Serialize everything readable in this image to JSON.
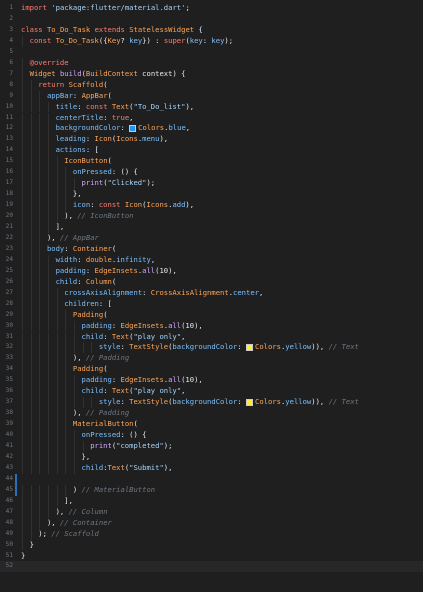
{
  "editor": {
    "language": "dart",
    "colors": {
      "background": "#1f1f1f",
      "line_number": "#6e7681",
      "keyword": "#ff7b72",
      "type": "#ffa657",
      "string": "#a5d6ff",
      "property": "#79c0ff",
      "plain": "#e6edf3",
      "comment": "#6e7681",
      "annotation": "#ff7b72",
      "function": "#d2a8ff",
      "swatch_blue": "#2196f3",
      "swatch_yellow": "#ffeb3b"
    },
    "lines": [
      {
        "n": "1",
        "indent": 0,
        "tokens": [
          [
            "kw",
            "import "
          ],
          [
            "str",
            "'package:flutter/material.dart'"
          ],
          [
            "p",
            ";"
          ]
        ]
      },
      {
        "n": "2",
        "indent": 0,
        "tokens": []
      },
      {
        "n": "3",
        "indent": 0,
        "tokens": [
          [
            "kw",
            "class "
          ],
          [
            "ty",
            "To_Do_Task"
          ],
          [
            "kw",
            " extends "
          ],
          [
            "ty",
            "StatelessWidget"
          ],
          [
            "p",
            " {"
          ]
        ]
      },
      {
        "n": "4",
        "indent": 1,
        "tokens": [
          [
            "kw",
            "const "
          ],
          [
            "ty",
            "To_Do_Task"
          ],
          [
            "p",
            "({"
          ],
          [
            "ty",
            "Key"
          ],
          [
            "p",
            "? "
          ],
          [
            "prop",
            "key"
          ],
          [
            "p",
            "}) : "
          ],
          [
            "kw",
            "super"
          ],
          [
            "p",
            "("
          ],
          [
            "prop",
            "key"
          ],
          [
            "p",
            ": "
          ],
          [
            "prop",
            "key"
          ],
          [
            "p",
            ");"
          ]
        ]
      },
      {
        "n": "5",
        "indent": 0,
        "tokens": []
      },
      {
        "n": "6",
        "indent": 1,
        "tokens": [
          [
            "ann",
            "@override"
          ]
        ]
      },
      {
        "n": "7",
        "indent": 1,
        "tokens": [
          [
            "ty",
            "Widget"
          ],
          [
            "p",
            " "
          ],
          [
            "fn",
            "build"
          ],
          [
            "p",
            "("
          ],
          [
            "ty",
            "BuildContext"
          ],
          [
            "p",
            " context) {"
          ]
        ]
      },
      {
        "n": "8",
        "indent": 2,
        "tokens": [
          [
            "kw",
            "return "
          ],
          [
            "ty",
            "Scaffold"
          ],
          [
            "p",
            "("
          ]
        ]
      },
      {
        "n": "9",
        "indent": 3,
        "tokens": [
          [
            "prop",
            "appBar"
          ],
          [
            "p",
            ": "
          ],
          [
            "ty",
            "AppBar"
          ],
          [
            "p",
            "("
          ]
        ]
      },
      {
        "n": "10",
        "indent": 4,
        "tokens": [
          [
            "prop",
            "title"
          ],
          [
            "p",
            ": "
          ],
          [
            "kw",
            "const "
          ],
          [
            "ty",
            "Text"
          ],
          [
            "p",
            "("
          ],
          [
            "str",
            "\"To_Do_list\""
          ],
          [
            "p",
            "),"
          ]
        ]
      },
      {
        "n": "11",
        "indent": 4,
        "tokens": [
          [
            "prop",
            "centerTitle"
          ],
          [
            "p",
            ": "
          ],
          [
            "kw",
            "true"
          ],
          [
            "p",
            ","
          ]
        ]
      },
      {
        "n": "12",
        "indent": 4,
        "tokens": [
          [
            "prop",
            "backgroundColor"
          ],
          [
            "p",
            ": "
          ],
          [
            "swb",
            ""
          ],
          [
            "ty",
            "Colors"
          ],
          [
            "p",
            "."
          ],
          [
            "prop",
            "blue"
          ],
          [
            "p",
            ","
          ]
        ]
      },
      {
        "n": "13",
        "indent": 4,
        "tokens": [
          [
            "prop",
            "leading"
          ],
          [
            "p",
            ": "
          ],
          [
            "ty",
            "Icon"
          ],
          [
            "p",
            "("
          ],
          [
            "ty",
            "Icons"
          ],
          [
            "p",
            "."
          ],
          [
            "prop",
            "menu"
          ],
          [
            "p",
            "),"
          ]
        ]
      },
      {
        "n": "14",
        "indent": 4,
        "tokens": [
          [
            "prop",
            "actions"
          ],
          [
            "p",
            ": ["
          ]
        ]
      },
      {
        "n": "15",
        "indent": 5,
        "tokens": [
          [
            "ty",
            "IconButton"
          ],
          [
            "p",
            "("
          ]
        ]
      },
      {
        "n": "16",
        "indent": 6,
        "tokens": [
          [
            "prop",
            "onPressed"
          ],
          [
            "p",
            ": () {"
          ]
        ]
      },
      {
        "n": "17",
        "indent": 7,
        "tokens": [
          [
            "fn",
            "print"
          ],
          [
            "p",
            "("
          ],
          [
            "str",
            "\"Clicked\""
          ],
          [
            "p",
            ");"
          ]
        ]
      },
      {
        "n": "18",
        "indent": 6,
        "tokens": [
          [
            "p",
            "},"
          ]
        ]
      },
      {
        "n": "19",
        "indent": 6,
        "tokens": [
          [
            "prop",
            "icon"
          ],
          [
            "p",
            ": "
          ],
          [
            "kw",
            "const "
          ],
          [
            "ty",
            "Icon"
          ],
          [
            "p",
            "("
          ],
          [
            "ty",
            "Icons"
          ],
          [
            "p",
            "."
          ],
          [
            "prop",
            "add"
          ],
          [
            "p",
            "),"
          ]
        ]
      },
      {
        "n": "20",
        "indent": 5,
        "tokens": [
          [
            "p",
            "), "
          ],
          [
            "cm",
            "// IconButton"
          ]
        ]
      },
      {
        "n": "21",
        "indent": 4,
        "tokens": [
          [
            "p",
            "],"
          ]
        ]
      },
      {
        "n": "22",
        "indent": 3,
        "tokens": [
          [
            "p",
            "), "
          ],
          [
            "cm",
            "// AppBar"
          ]
        ]
      },
      {
        "n": "23",
        "indent": 3,
        "tokens": [
          [
            "prop",
            "body"
          ],
          [
            "p",
            ": "
          ],
          [
            "ty",
            "Container"
          ],
          [
            "p",
            "("
          ]
        ]
      },
      {
        "n": "24",
        "indent": 4,
        "tokens": [
          [
            "prop",
            "width"
          ],
          [
            "p",
            ": "
          ],
          [
            "ty",
            "double"
          ],
          [
            "p",
            "."
          ],
          [
            "prop",
            "infinity"
          ],
          [
            "p",
            ","
          ]
        ]
      },
      {
        "n": "25",
        "indent": 4,
        "tokens": [
          [
            "prop",
            "padding"
          ],
          [
            "p",
            ": "
          ],
          [
            "ty",
            "EdgeInsets"
          ],
          [
            "p",
            "."
          ],
          [
            "fn",
            "all"
          ],
          [
            "p",
            "(10),"
          ]
        ]
      },
      {
        "n": "26",
        "indent": 4,
        "tokens": [
          [
            "prop",
            "child"
          ],
          [
            "p",
            ": "
          ],
          [
            "ty",
            "Column"
          ],
          [
            "p",
            "("
          ]
        ]
      },
      {
        "n": "27",
        "indent": 5,
        "tokens": [
          [
            "prop",
            "crossAxisAlignment"
          ],
          [
            "p",
            ": "
          ],
          [
            "ty",
            "CrossAxisAlignment"
          ],
          [
            "p",
            "."
          ],
          [
            "prop",
            "center"
          ],
          [
            "p",
            ","
          ]
        ]
      },
      {
        "n": "28",
        "indent": 5,
        "tokens": [
          [
            "prop",
            "children"
          ],
          [
            "p",
            ": ["
          ]
        ]
      },
      {
        "n": "29",
        "indent": 6,
        "tokens": [
          [
            "ty",
            "Padding"
          ],
          [
            "p",
            "("
          ]
        ]
      },
      {
        "n": "30",
        "indent": 7,
        "tokens": [
          [
            "prop",
            "padding"
          ],
          [
            "p",
            ": "
          ],
          [
            "ty",
            "EdgeInsets"
          ],
          [
            "p",
            "."
          ],
          [
            "fn",
            "all"
          ],
          [
            "p",
            "(10),"
          ]
        ]
      },
      {
        "n": "31",
        "indent": 7,
        "tokens": [
          [
            "prop",
            "child"
          ],
          [
            "p",
            ": "
          ],
          [
            "ty",
            "Text"
          ],
          [
            "p",
            "("
          ],
          [
            "str",
            "\"play only\""
          ],
          [
            "p",
            ","
          ]
        ]
      },
      {
        "n": "32",
        "indent": 9,
        "tokens": [
          [
            "prop",
            "style"
          ],
          [
            "p",
            ": "
          ],
          [
            "ty",
            "TextStyle"
          ],
          [
            "p",
            "("
          ],
          [
            "prop",
            "backgroundColor"
          ],
          [
            "p",
            ": "
          ],
          [
            "swy",
            ""
          ],
          [
            "ty",
            "Colors"
          ],
          [
            "p",
            "."
          ],
          [
            "prop",
            "yellow"
          ],
          [
            "p",
            ")), "
          ],
          [
            "cm",
            "// Text"
          ]
        ]
      },
      {
        "n": "33",
        "indent": 6,
        "tokens": [
          [
            "p",
            "), "
          ],
          [
            "cm",
            "// Padding"
          ]
        ]
      },
      {
        "n": "34",
        "indent": 6,
        "tokens": [
          [
            "ty",
            "Padding"
          ],
          [
            "p",
            "("
          ]
        ]
      },
      {
        "n": "35",
        "indent": 7,
        "tokens": [
          [
            "prop",
            "padding"
          ],
          [
            "p",
            ": "
          ],
          [
            "ty",
            "EdgeInsets"
          ],
          [
            "p",
            "."
          ],
          [
            "fn",
            "all"
          ],
          [
            "p",
            "(10),"
          ]
        ]
      },
      {
        "n": "36",
        "indent": 7,
        "tokens": [
          [
            "prop",
            "child"
          ],
          [
            "p",
            ": "
          ],
          [
            "ty",
            "Text"
          ],
          [
            "p",
            "("
          ],
          [
            "str",
            "\"play only\""
          ],
          [
            "p",
            ","
          ]
        ]
      },
      {
        "n": "37",
        "indent": 9,
        "tokens": [
          [
            "prop",
            "style"
          ],
          [
            "p",
            ": "
          ],
          [
            "ty",
            "TextStyle"
          ],
          [
            "p",
            "("
          ],
          [
            "prop",
            "backgroundColor"
          ],
          [
            "p",
            ": "
          ],
          [
            "swy",
            ""
          ],
          [
            "ty",
            "Colors"
          ],
          [
            "p",
            "."
          ],
          [
            "prop",
            "yellow"
          ],
          [
            "p",
            ")), "
          ],
          [
            "cm",
            "// Text"
          ]
        ]
      },
      {
        "n": "38",
        "indent": 6,
        "tokens": [
          [
            "p",
            "), "
          ],
          [
            "cm",
            "// Padding"
          ]
        ]
      },
      {
        "n": "39",
        "indent": 6,
        "tokens": [
          [
            "ty",
            "MaterialButton"
          ],
          [
            "p",
            "("
          ]
        ]
      },
      {
        "n": "40",
        "indent": 7,
        "tokens": [
          [
            "prop",
            "onPressed"
          ],
          [
            "p",
            ": () {"
          ]
        ]
      },
      {
        "n": "41",
        "indent": 8,
        "tokens": [
          [
            "fn",
            "print"
          ],
          [
            "p",
            "("
          ],
          [
            "str",
            "\"completed\""
          ],
          [
            "p",
            ");"
          ]
        ]
      },
      {
        "n": "42",
        "indent": 7,
        "tokens": [
          [
            "p",
            "},"
          ]
        ]
      },
      {
        "n": "43",
        "indent": 7,
        "tokens": [
          [
            "prop",
            "child"
          ],
          [
            "p",
            ":"
          ],
          [
            "ty",
            "Text"
          ],
          [
            "p",
            "("
          ],
          [
            "str",
            "\"Submit\""
          ],
          [
            "p",
            "),"
          ]
        ]
      },
      {
        "n": "44",
        "indent": 0,
        "tokens": []
      },
      {
        "n": "45",
        "indent": 6,
        "tokens": [
          [
            "p",
            ") "
          ],
          [
            "cm",
            "// MaterialButton"
          ]
        ]
      },
      {
        "n": "46",
        "indent": 5,
        "tokens": [
          [
            "p",
            "],"
          ]
        ]
      },
      {
        "n": "47",
        "indent": 4,
        "tokens": [
          [
            "p",
            "), "
          ],
          [
            "cm",
            "// Column"
          ]
        ]
      },
      {
        "n": "48",
        "indent": 3,
        "tokens": [
          [
            "p",
            "), "
          ],
          [
            "cm",
            "// Container"
          ]
        ]
      },
      {
        "n": "49",
        "indent": 2,
        "tokens": [
          [
            "p",
            "); "
          ],
          [
            "cm",
            "// Scaffold"
          ]
        ]
      },
      {
        "n": "50",
        "indent": 1,
        "tokens": [
          [
            "p",
            "}"
          ]
        ]
      },
      {
        "n": "51",
        "indent": 0,
        "tokens": [
          [
            "p",
            "}"
          ]
        ]
      },
      {
        "n": "52",
        "indent": 0,
        "tokens": []
      }
    ]
  }
}
